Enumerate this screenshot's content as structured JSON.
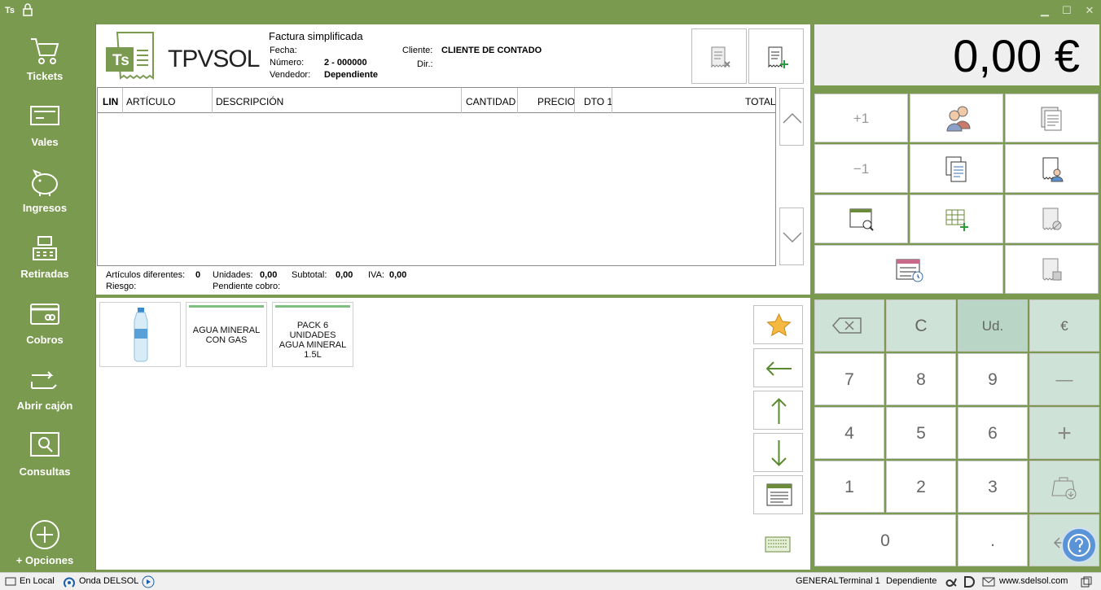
{
  "titlebar": {
    "app_code": "Ts"
  },
  "sidebar": {
    "items": [
      {
        "label": "Tickets",
        "icon": "cart-icon"
      },
      {
        "label": "Vales",
        "icon": "voucher-icon"
      },
      {
        "label": "Ingresos",
        "icon": "piggy-bank-icon"
      },
      {
        "label": "Retiradas",
        "icon": "cash-register-icon"
      },
      {
        "label": "Cobros",
        "icon": "card-icon"
      },
      {
        "label": "Abrir cajón",
        "icon": "open-drawer-icon"
      },
      {
        "label": "Consultas",
        "icon": "search-icon"
      }
    ],
    "options_label": "+ Opciones"
  },
  "document": {
    "logo_text": "TPVSOL",
    "logo_badge": "Ts",
    "doc_type": "Factura simplificada",
    "fecha_label": "Fecha:",
    "fecha_value": "",
    "numero_label": "Número:",
    "numero_value": "2 - 000000",
    "vendedor_label": "Vendedor:",
    "vendedor_value": "Dependiente",
    "cliente_label": "Cliente:",
    "cliente_value": "CLIENTE DE CONTADO",
    "dir_label": "Dir.:",
    "dir_value": ""
  },
  "grid": {
    "columns": [
      "LIN",
      "ARTÍCULO",
      "DESCRIPCIÓN",
      "CANTIDAD",
      "PRECIO",
      "DTO 1",
      "TOTAL"
    ]
  },
  "totals": {
    "articulos_label": "Artículos diferentes:",
    "articulos_value": "0",
    "unidades_label": "Unidades:",
    "unidades_value": "0,00",
    "subtotal_label": "Subtotal:",
    "subtotal_value": "0,00",
    "iva_label": "IVA:",
    "iva_value": "0,00",
    "riesgo_label": "Riesgo:",
    "pendiente_label": "Pendiente cobro:"
  },
  "products": [
    {
      "label": "",
      "type": "image"
    },
    {
      "label": "AGUA MINERAL CON GAS",
      "type": "text"
    },
    {
      "label": "PACK 6 UNIDADES AGUA MINERAL 1.5L",
      "type": "text"
    }
  ],
  "amount": {
    "value": "0,00 €"
  },
  "func_buttons": {
    "plus_one": "+1",
    "minus_one": "−1"
  },
  "keypad": {
    "backspace": "⌫",
    "clear": "C",
    "units": "Ud.",
    "euro": "€",
    "k7": "7",
    "k8": "8",
    "k9": "9",
    "minus": "—",
    "k4": "4",
    "k5": "5",
    "k6": "6",
    "plus": "+",
    "k1": "1",
    "k2": "2",
    "k3": "3",
    "k0": "0",
    "dot": "."
  },
  "status": {
    "local": "En Local",
    "onda": "Onda DELSOL",
    "general": "GENERAL",
    "terminal": "Terminal 1",
    "user": "Dependiente",
    "web": "www.sdelsol.com"
  },
  "colors": {
    "brand_green": "#7a9a4f",
    "keypad_tint": "#cfe2d7",
    "keypad_dark": "#b9d5c6"
  }
}
